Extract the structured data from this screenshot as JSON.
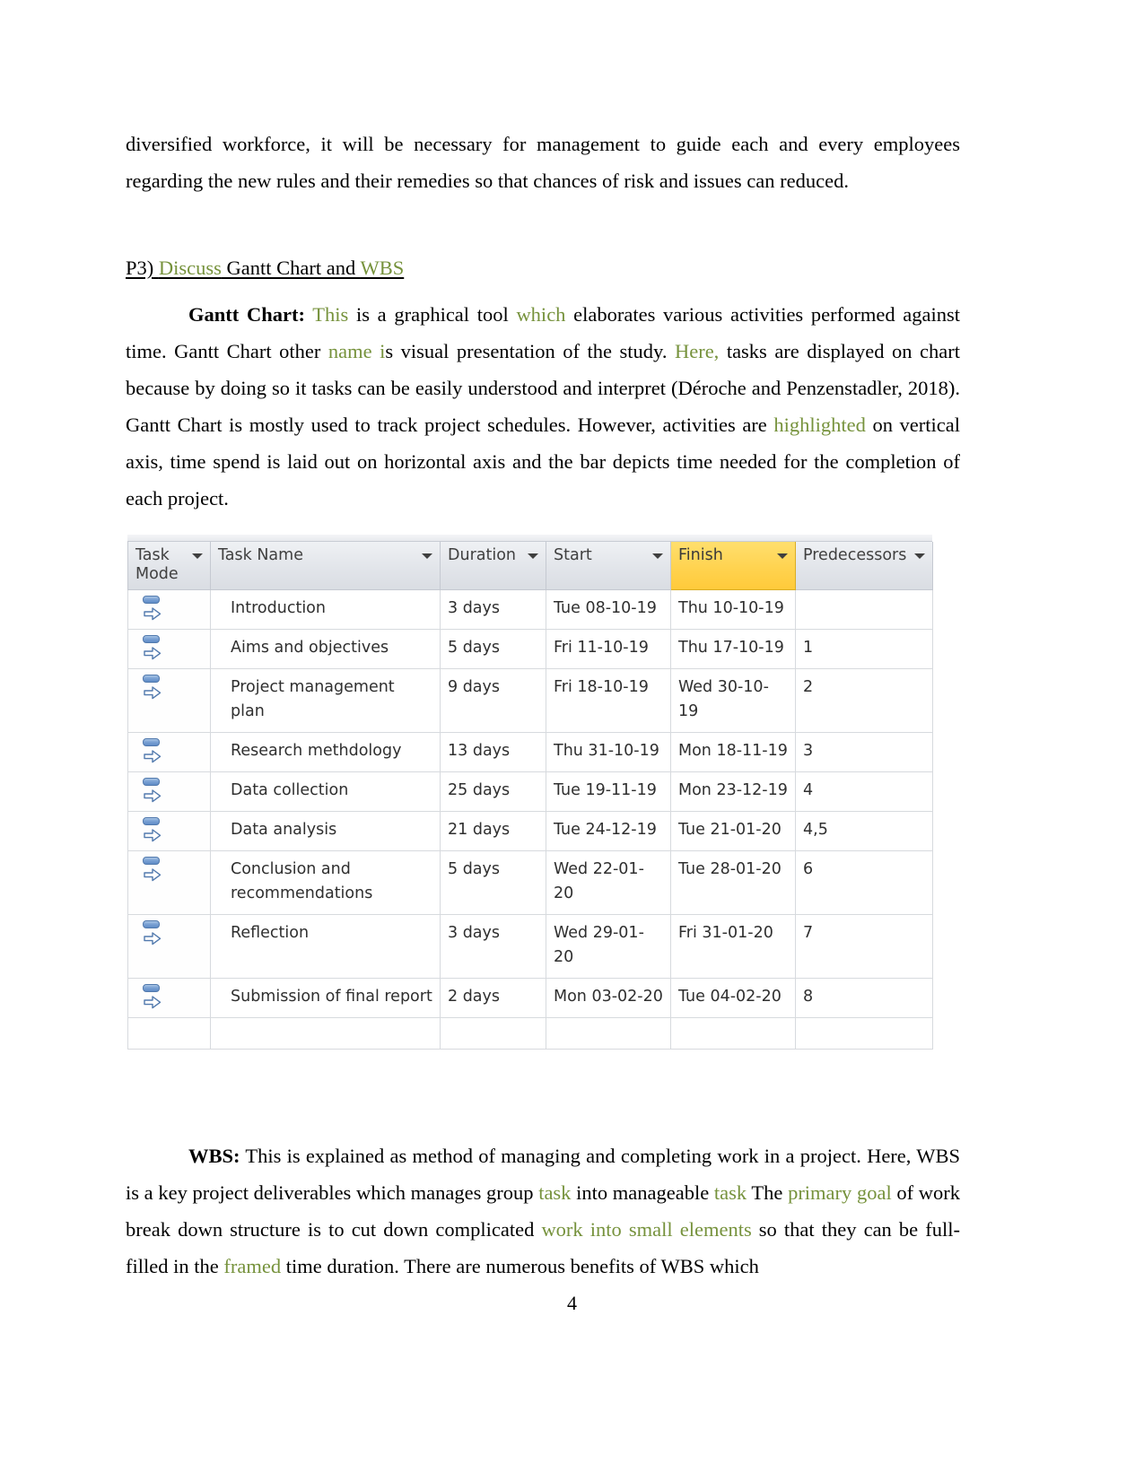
{
  "document": {
    "page_number": "4",
    "accent_green": "#76923c",
    "highlight_yellow": "#ffd24d"
  },
  "intro_paragraph": {
    "line": "diversified workforce, it will be necessary for management to guide each and every employees regarding the new rules and their remedies so that chances of risk and issues can reduced."
  },
  "heading": {
    "prefix": "P3) ",
    "green_word": "Discuss",
    "middle": " Gantt Chart and ",
    "green_word2": "WBS"
  },
  "gantt_paragraph": {
    "label": "Gantt Chart:",
    "s1_green": "This",
    "s2": " is a graphical tool ",
    "s3_green": "which",
    "s4": " elaborates various activities performed against time. Gantt Chart other ",
    "s5_green": "name i",
    "s6": "s visual presentation of the study. ",
    "s7_green": "Here,",
    "s8": " tasks are displayed on chart because by doing so it tasks can be easily understood and interpret (Déroche and Penzenstadler, 2018). Gantt Chart is mostly used to track project schedules. However, activities are ",
    "s9_green": "highlighted",
    "s10": " on vertical axis, time spend is laid out on horizontal axis and the bar depicts time needed for the completion of each project."
  },
  "gantt_table": {
    "columns": [
      {
        "label": "Task Mode",
        "highlighted": false,
        "has_filter": true
      },
      {
        "label": "Task Name",
        "highlighted": false,
        "has_filter": true
      },
      {
        "label": "Duration",
        "highlighted": false,
        "has_filter": true
      },
      {
        "label": "Start",
        "highlighted": false,
        "has_filter": true
      },
      {
        "label": "Finish",
        "highlighted": true,
        "has_filter": true
      },
      {
        "label": "Predecessors",
        "highlighted": false,
        "has_filter": true
      }
    ],
    "rows": [
      {
        "mode_icon": "manually-scheduled-icon",
        "name": "Introduction",
        "duration": "3 days",
        "start": "Tue 08-10-19",
        "finish": "Thu 10-10-19",
        "predecessors": ""
      },
      {
        "mode_icon": "manually-scheduled-icon",
        "name": "Aims and objectives",
        "duration": "5 days",
        "start": "Fri 11-10-19",
        "finish": "Thu 17-10-19",
        "predecessors": "1"
      },
      {
        "mode_icon": "manually-scheduled-icon",
        "name": "Project management plan",
        "duration": "9 days",
        "start": "Fri 18-10-19",
        "finish": "Wed 30-10-19",
        "predecessors": "2"
      },
      {
        "mode_icon": "manually-scheduled-icon",
        "name": "Research methdology",
        "duration": "13 days",
        "start": "Thu 31-10-19",
        "finish": "Mon 18-11-19",
        "predecessors": "3"
      },
      {
        "mode_icon": "manually-scheduled-icon",
        "name": "Data collection",
        "duration": "25 days",
        "start": "Tue 19-11-19",
        "finish": "Mon 23-12-19",
        "predecessors": "4"
      },
      {
        "mode_icon": "manually-scheduled-icon",
        "name": "Data analysis",
        "duration": "21 days",
        "start": "Tue 24-12-19",
        "finish": "Tue 21-01-20",
        "predecessors": "4,5"
      },
      {
        "mode_icon": "manually-scheduled-icon",
        "name": "Conclusion and recommendations",
        "duration": "5 days",
        "start": "Wed 22-01-20",
        "finish": "Tue 28-01-20",
        "predecessors": "6"
      },
      {
        "mode_icon": "manually-scheduled-icon",
        "name": "Reflection",
        "duration": "3 days",
        "start": "Wed 29-01-20",
        "finish": "Fri 31-01-20",
        "predecessors": "7"
      },
      {
        "mode_icon": "manually-scheduled-icon",
        "name": "Submission of final report",
        "duration": "2 days",
        "start": "Mon 03-02-20",
        "finish": "Tue 04-02-20",
        "predecessors": "8"
      }
    ]
  },
  "wbs_paragraph": {
    "label": "WBS:",
    "s1": " This is explained as method of managing and completing work in a project. Here, WBS is a key project deliverables which manages group ",
    "s2_green": "task",
    "s3": " into manageable ",
    "s4_green": "task",
    "s5": "  The ",
    "s6_green": "primary goal",
    "s7": " of work break down structure is to cut down complicated ",
    "s8_green": "work into small elements",
    "s9": " so that they can be full-filled in the ",
    "s10_green": "framed",
    "s11": " time duration. There are numerous benefits of WBS which"
  }
}
